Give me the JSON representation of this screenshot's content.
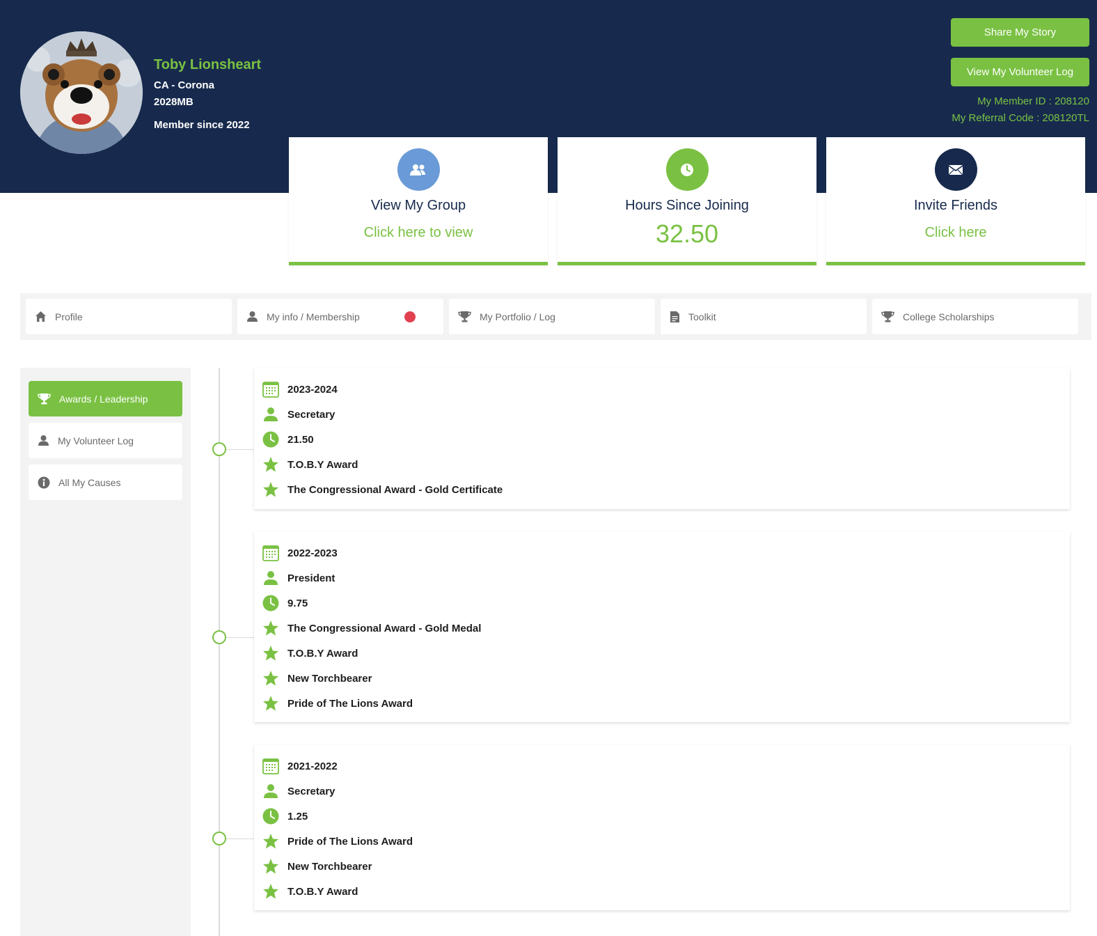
{
  "profile": {
    "name": "Toby Lionsheart",
    "location": "CA - Corona",
    "code": "2028MB",
    "member_since": "Member since 2022"
  },
  "header": {
    "share_story": "Share My Story",
    "view_log": "View My Volunteer Log",
    "member_id": "My Member ID : 208120",
    "referral_code": "My Referral Code : 208120TL"
  },
  "cards": {
    "group": {
      "title": "View My Group",
      "link": "Click here to view",
      "icon": "group-icon"
    },
    "hours": {
      "title": "Hours Since Joining",
      "value": "32.50",
      "icon": "clock-icon"
    },
    "invite": {
      "title": "Invite Friends",
      "link": "Click here",
      "icon": "envelope-icon"
    }
  },
  "tabs": [
    {
      "label": "Profile",
      "icon": "home-icon"
    },
    {
      "label": "My info / Membership",
      "icon": "user-icon",
      "badge": "red-dot"
    },
    {
      "label": "My Portfolio / Log",
      "icon": "trophy-icon"
    },
    {
      "label": "Toolkit",
      "icon": "document-icon"
    },
    {
      "label": "College Scholarships",
      "icon": "trophy-icon"
    }
  ],
  "sidebar": {
    "items": [
      {
        "label": "Awards / Leadership",
        "icon": "trophy-icon",
        "active": true
      },
      {
        "label": "My Volunteer Log",
        "icon": "user-icon",
        "active": false
      },
      {
        "label": "All My Causes",
        "icon": "info-icon",
        "active": false
      }
    ]
  },
  "timeline": [
    {
      "year": "2023-2024",
      "role": "Secretary",
      "hours": "21.50",
      "awards": [
        "T.O.B.Y Award",
        "The Congressional Award - Gold Certificate"
      ]
    },
    {
      "year": "2022-2023",
      "role": "President",
      "hours": "9.75",
      "awards": [
        "The Congressional Award - Gold Medal",
        "T.O.B.Y Award",
        "New Torchbearer",
        "Pride of The Lions Award"
      ]
    },
    {
      "year": "2021-2022",
      "role": "Secretary",
      "hours": "1.25",
      "awards": [
        "Pride of The Lions Award",
        "New Torchbearer",
        "T.O.B.Y Award"
      ]
    }
  ],
  "colors": {
    "navy": "#172a4d",
    "green": "#7ac143",
    "blue": "#6a9bd8",
    "badge_red": "#e1414f"
  }
}
